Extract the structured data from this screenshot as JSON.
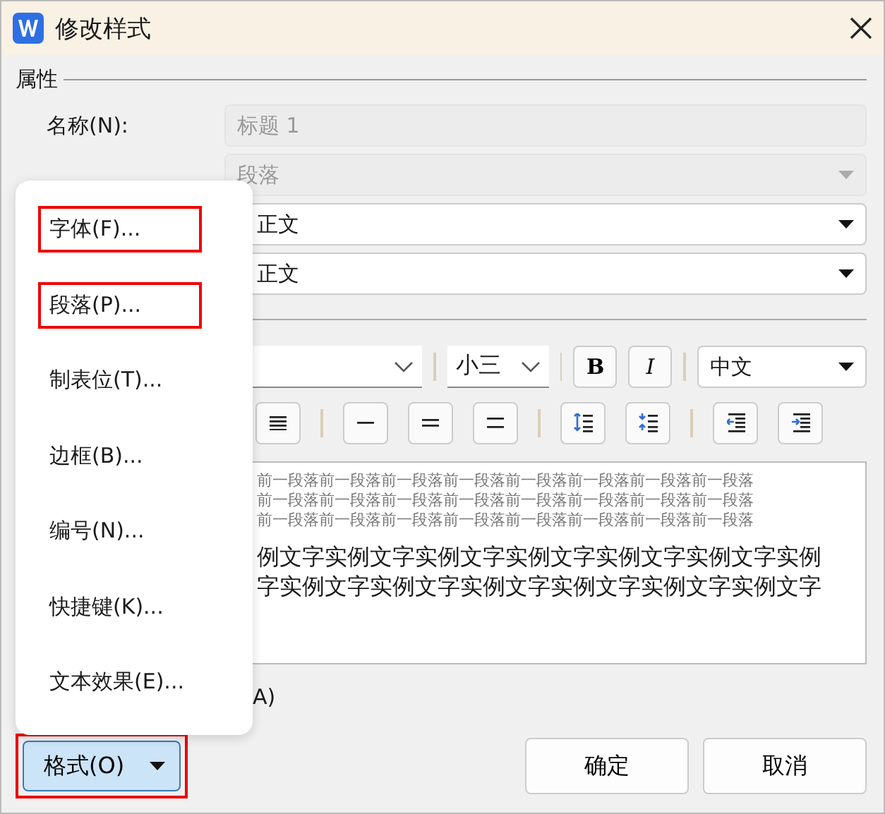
{
  "window": {
    "title": "修改样式"
  },
  "properties": {
    "heading": "属性",
    "name_label": "名称(N):",
    "name_value": "标题 1",
    "type_value": "段落",
    "combo_1": "正文",
    "combo_2": "正文"
  },
  "format_bar": {
    "size": "小三",
    "bold": "B",
    "italic": "I",
    "script": "中文"
  },
  "preview": {
    "prev_lines": [
      "前一段落前一段落前一段落前一段落前一段落前一段落前一段落前一段落",
      "前一段落前一段落前一段落前一段落前一段落前一段落前一段落前一段落",
      "前一段落前一段落前一段落前一段落前一段落前一段落前一段落前一段落"
    ],
    "sample_lines": [
      "例文字实例文字实例文字实例文字实例文字实例文字实例",
      "字实例文字实例文字实例文字实例文字实例文字实例文字"
    ]
  },
  "option_label": "A)",
  "menu": [
    {
      "label": "字体(F)...",
      "highlighted": true
    },
    {
      "label": "段落(P)...",
      "highlighted": true
    },
    {
      "label": "制表位(T)...",
      "highlighted": false
    },
    {
      "label": "边框(B)...",
      "highlighted": false
    },
    {
      "label": "编号(N)...",
      "highlighted": false
    },
    {
      "label": "快捷键(K)...",
      "highlighted": false
    },
    {
      "label": "文本效果(E)...",
      "highlighted": false
    }
  ],
  "format_button": {
    "label": "格式(O)",
    "highlighted": true
  },
  "buttons": [
    "确定",
    "取消"
  ]
}
